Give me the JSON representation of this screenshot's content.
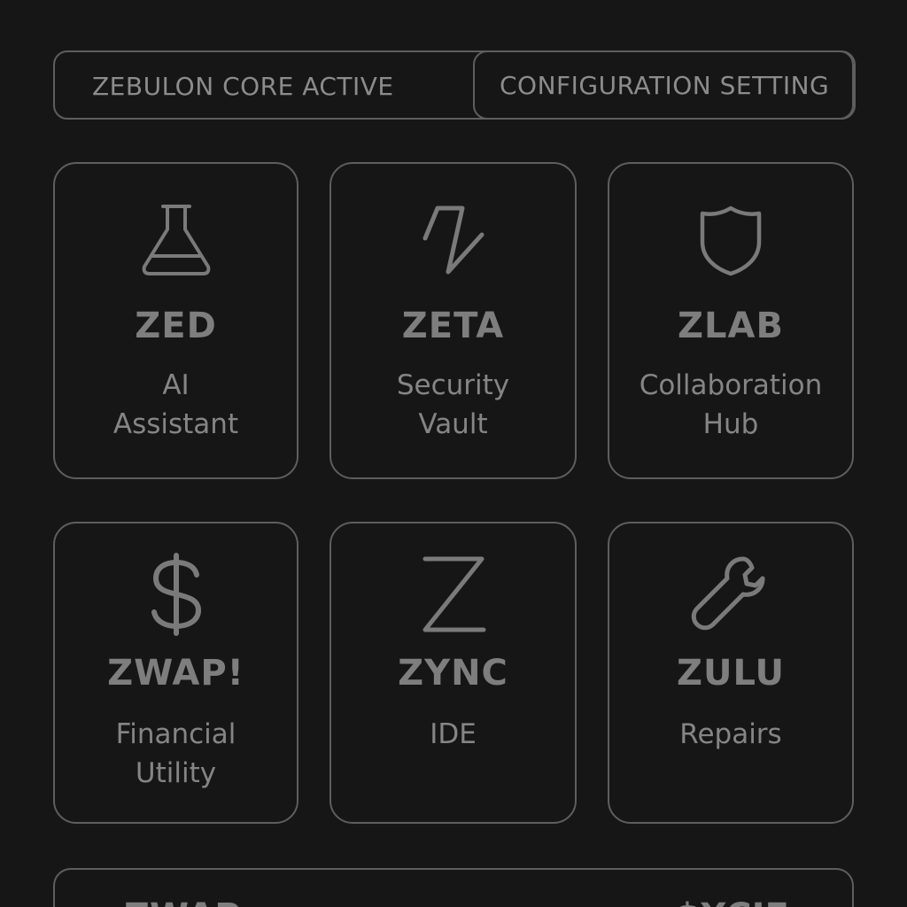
{
  "topbar": {
    "status_label": "ZEBULON CORE ACTIVE",
    "config_label": "CONFIGURATION SETTING"
  },
  "apps": [
    {
      "name": "ZED",
      "desc_line1": "AI",
      "desc_line2": "Assistant",
      "icon": "flask-icon"
    },
    {
      "name": "ZETA",
      "desc_line1": "Security",
      "desc_line2": "Vault",
      "icon": "zigzag-icon"
    },
    {
      "name": "ZLAB",
      "desc_line1": "Collaboration",
      "desc_line2": "Hub",
      "icon": "shield-icon"
    },
    {
      "name": "ZWAP!",
      "desc_line1": "Financial",
      "desc_line2": "Utility",
      "icon": "dollar-icon"
    },
    {
      "name": "ZYNC",
      "desc_line1": "IDE",
      "desc_line2": "",
      "icon": "z-letter-icon"
    },
    {
      "name": "ZULU",
      "desc_line1": "Repairs",
      "desc_line2": "",
      "icon": "wrench-icon"
    }
  ],
  "bottom_panel": {
    "left_text": "ZWAP",
    "right_text": "$XCIE"
  },
  "colors": {
    "background": "#161617",
    "border": "#5e5e5e",
    "text": "#858585"
  }
}
